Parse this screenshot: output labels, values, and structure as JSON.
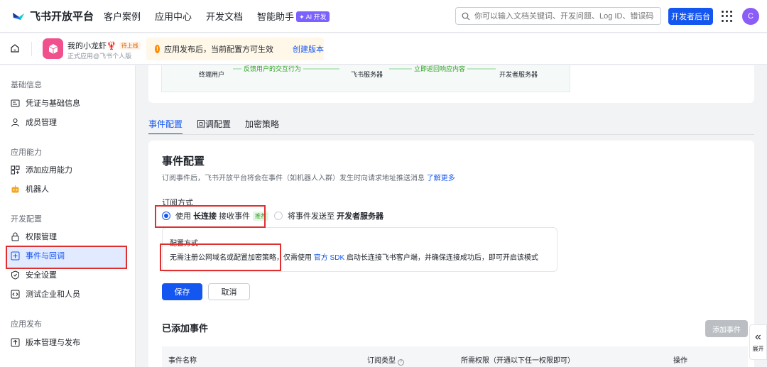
{
  "topnav": {
    "brand": "飞书开放平台",
    "links": [
      "客户案例",
      "应用中心",
      "开发文档",
      "智能助手"
    ],
    "ai_badge": "✦ AI 开发",
    "search_placeholder": "你可以输入文档关键词、开发问题、Log ID、错误码",
    "dev_console": "开发者后台",
    "avatar": "C",
    "colors": {
      "primary": "#1456f0",
      "ai": "#7b61ff",
      "avatar": "#8b5cf6"
    }
  },
  "appbar": {
    "app_name": "我的小龙虾🦞",
    "app_status": "待上线",
    "app_sub": "正式应用@飞书个人版",
    "notice": "应用发布后，当前配置方可生效",
    "notice_link": "创建版本"
  },
  "sidebar": {
    "groups": [
      {
        "title": "基础信息",
        "items": [
          "凭证与基础信息",
          "成员管理"
        ]
      },
      {
        "title": "应用能力",
        "items": [
          "添加应用能力",
          "机器人"
        ]
      },
      {
        "title": "开发配置",
        "items": [
          "权限管理",
          "事件与回调",
          "安全设置",
          "测试企业和人员"
        ]
      },
      {
        "title": "应用发布",
        "items": [
          "版本管理与发布"
        ]
      }
    ],
    "active": "事件与回调"
  },
  "flow": {
    "end_user": "终端用户",
    "feishu_server": "飞书服务器",
    "dev_server": "开发者服务器",
    "arrow_left": "反馈用户的交互行为",
    "arrow_right": "立即返回响应内容"
  },
  "tabs": [
    "事件配置",
    "回调配置",
    "加密策略"
  ],
  "event_config": {
    "title": "事件配置",
    "desc": "订阅事件后，飞书开放平台将会在事件（如机器人入群）发生时向请求地址推送消息",
    "learn_more": "了解更多",
    "subscribe_label": "订阅方式",
    "option1_prefix": "使用",
    "option1_strong": "长连接",
    "option1_suffix": "接收事件",
    "option1_badge": "推荐",
    "option2_prefix": "将事件发送至",
    "option2_strong": "开发者服务器",
    "config_label": "配置方式",
    "config_text_1": "无需注册公网域名或配置加密策略，仅需使用",
    "config_link": "官方 SDK",
    "config_text_2": "启动长连接飞书客户端，并确保连接成功后，即可开启该模式",
    "save": "保存",
    "cancel": "取消",
    "added_title": "已添加事件",
    "add_event": "添加事件",
    "table_headers": [
      "事件名称",
      "订阅类型",
      "所需权限（开通以下任一权限即可）",
      "操作"
    ]
  },
  "expand": {
    "chevron": "«",
    "label": "展开"
  }
}
